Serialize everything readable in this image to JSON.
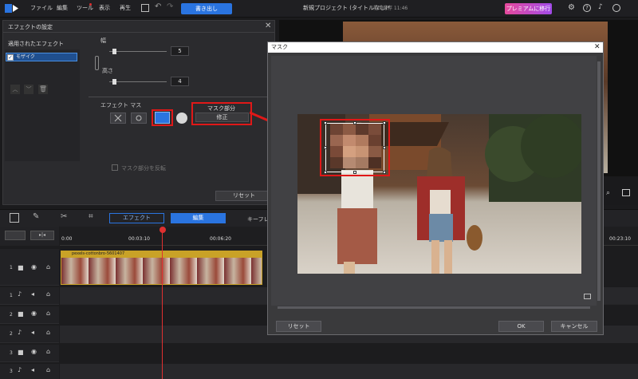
{
  "menubar": {
    "items": [
      "ファイル",
      "編集",
      "ツール",
      "表示",
      "再生"
    ],
    "export_label": "書き出し",
    "title": "新規プロジェクト (タイトルなし)*",
    "title_sub": "前回保存 11:46",
    "premium_label": "プレミアムに移行"
  },
  "effect_panel": {
    "title": "エフェクトの設定",
    "applied_label": "適用されたエフェクト",
    "effect_item": "モザイク",
    "width_label": "幅",
    "width_value": "5",
    "height_label": "高さ",
    "height_value": "4",
    "mask_label": "エフェクト マス",
    "mask_part_label": "マスク部分",
    "mask_edit_label": "修正",
    "invert_label": "マスク部分を反転",
    "reset_label": "リセット"
  },
  "timeline": {
    "tab_effect": "エフェクト",
    "tab_edit": "編集",
    "tab_keyframe": "キーフレー",
    "times": [
      "0:00",
      "00:03:10",
      "00:06:20",
      "00:23:10"
    ],
    "clip_name": "pexels-cottonbro-5601407",
    "track_numbers": [
      "1",
      "1",
      "2",
      "2",
      "3",
      "3"
    ]
  },
  "mask_dialog": {
    "title": "マスク",
    "reset_label": "リセット",
    "ok_label": "OK",
    "cancel_label": "キャンセル"
  },
  "colors": {
    "accent": "#2a74e0",
    "highlight_red": "#e01818",
    "playhead": "#e03030",
    "clip_header": "#c9a227"
  }
}
